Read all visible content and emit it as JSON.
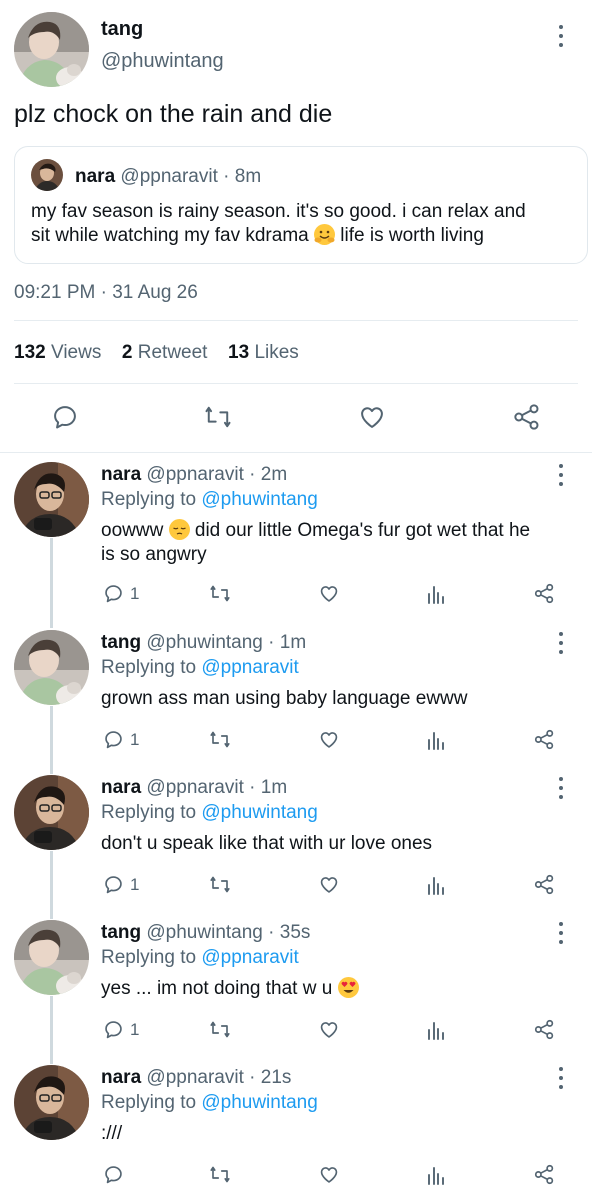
{
  "main_tweet": {
    "author_name": "tang",
    "author_handle": "@phuwintang",
    "text": "plz chock on the rain and die",
    "quoted": {
      "author_name": "nara",
      "author_handle": "@ppnaravit",
      "time": "8m",
      "text_line1": "my fav season is rainy season. it's so good. i can relax and",
      "text_line2_a": "sit while watching my fav kdrama",
      "text_line2_b": "life is worth living"
    },
    "timestamp": "09:21 PM · 31 Aug 26",
    "stats": {
      "views_count": "132",
      "views_label": "Views",
      "retweets_count": "2",
      "retweets_label": "Retweet",
      "likes_count": "13",
      "likes_label": "Likes"
    }
  },
  "replies": [
    {
      "name": "nara",
      "handle": "@ppnaravit",
      "time": "2m",
      "replying_label": "Replying to",
      "replying_to": "@phuwintang",
      "text_a": "oowww",
      "text_b": "did our little Omega's fur got wet that he",
      "text_line2": "is so angwry",
      "reply_count": "1"
    },
    {
      "name": "tang",
      "handle": "@phuwintang",
      "time": "1m",
      "replying_label": "Replying to",
      "replying_to": "@ppnaravit",
      "text": "grown ass man using baby language ewww",
      "reply_count": "1"
    },
    {
      "name": "nara",
      "handle": "@ppnaravit",
      "time": "1m",
      "replying_label": "Replying to",
      "replying_to": "@phuwintang",
      "text": "don't u speak like that with ur love ones",
      "reply_count": "1"
    },
    {
      "name": "tang",
      "handle": "@phuwintang",
      "time": "35s",
      "replying_label": "Replying to",
      "replying_to": "@ppnaravit",
      "text": "yes ... im not doing that w u",
      "reply_count": "1"
    },
    {
      "name": "nara",
      "handle": "@ppnaravit",
      "time": "21s",
      "replying_label": "Replying to",
      "replying_to": "@phuwintang",
      "text": ":///",
      "reply_count": ""
    }
  ],
  "icons": {
    "reply": "speech-bubble-icon",
    "retweet": "retweet-icon",
    "like": "heart-icon",
    "share": "share-icon",
    "analytics": "analytics-icon",
    "more": "more-vertical-icon"
  },
  "colors": {
    "link": "#1d9bf0",
    "muted": "#536471",
    "text": "#0f1419",
    "divider": "#e6ecf0"
  }
}
